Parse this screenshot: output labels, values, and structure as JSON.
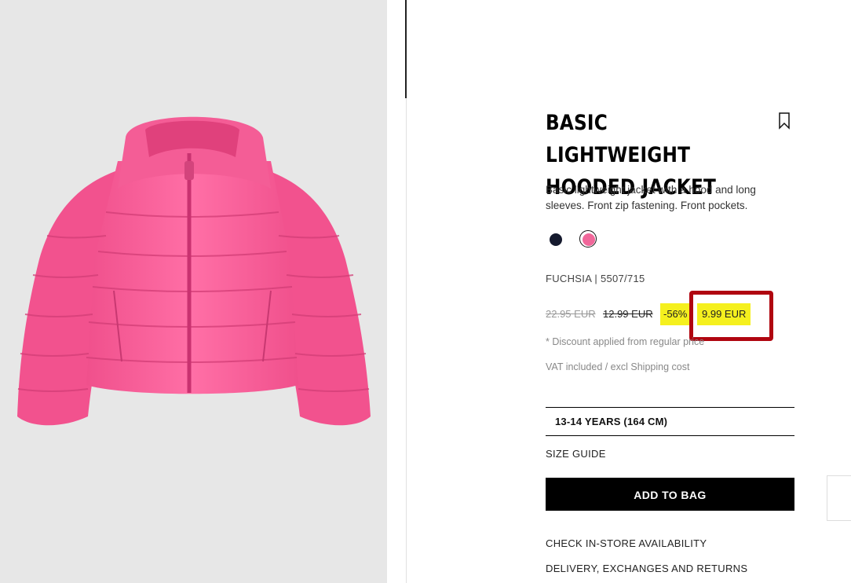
{
  "product": {
    "title_line1": "BASIC LIGHTWEIGHT",
    "title_line2": "HOODED JACKET",
    "description_line1": "Basic lightweight jacket with a hood and long",
    "description_line2": "sleeves. Front zip fastening. Front pockets.",
    "colors": [
      {
        "name": "navy",
        "hex": "#151a2e"
      },
      {
        "name": "fuchsia",
        "hex": "#f0679a",
        "selected": true
      }
    ],
    "color_code": "FUCHSIA | 5507/715"
  },
  "pricing": {
    "original_price": "22.95 EUR",
    "previous_price": "12.99 EUR",
    "discount": "-56%",
    "current_price": "9.99 EUR",
    "discount_note": "* Discount applied from regular price",
    "vat_note": "VAT included / excl Shipping cost",
    "highlight_color": "#f5f01e"
  },
  "size": {
    "selected": "13-14 YEARS (164 CM)",
    "guide_label": "SIZE GUIDE"
  },
  "actions": {
    "add_to_bag": "ADD TO BAG",
    "check_store": "CHECK IN-STORE AVAILABILITY",
    "delivery": "DELIVERY, EXCHANGES AND RETURNS"
  },
  "annotation": {
    "box_color": "#b00610"
  }
}
